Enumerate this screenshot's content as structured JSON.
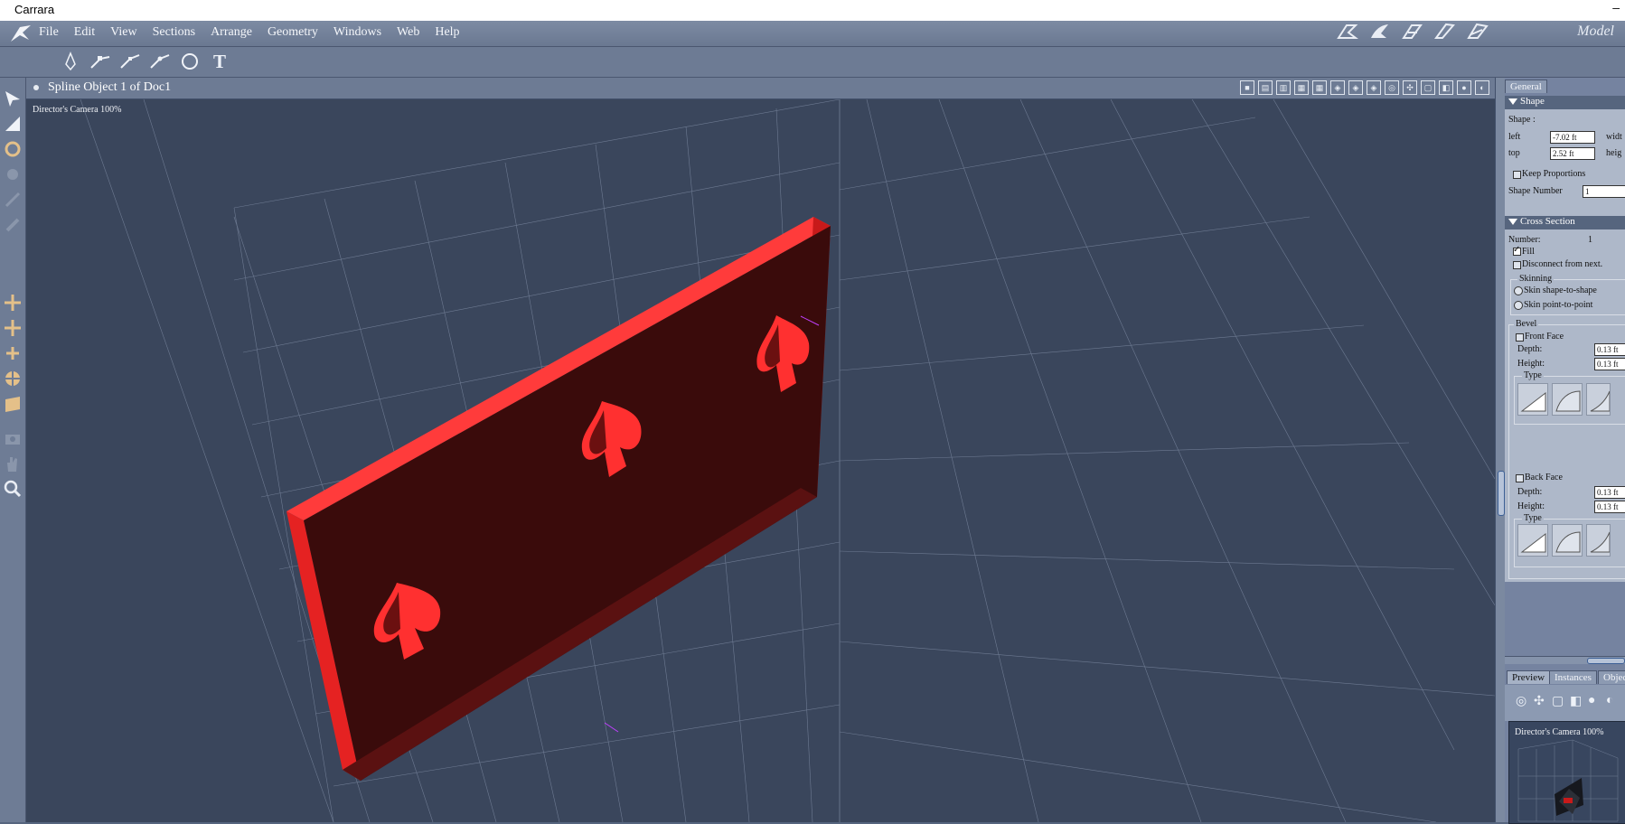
{
  "window": {
    "title": "Carrara"
  },
  "menu": {
    "items": [
      "File",
      "Edit",
      "View",
      "Sections",
      "Arrange",
      "Geometry",
      "Windows",
      "Web",
      "Help"
    ]
  },
  "room": {
    "label": "Model"
  },
  "toolbar": {
    "tools": [
      "pen-tool",
      "point-tool-a",
      "point-tool-b",
      "point-tool-c",
      "ellipse-tool",
      "text-tool"
    ],
    "text_tool_glyph": "T"
  },
  "viewport": {
    "title": "Spline Object 1 of Doc1",
    "camera_label": "Director's Camera 100%"
  },
  "properties": {
    "tab_general": "General",
    "shape": {
      "header": "Shape",
      "shape_label": "Shape :",
      "left_label": "left",
      "left_value": "-7.02 ft",
      "width_label": "widt",
      "top_label": "top",
      "top_value": "2.52 ft",
      "height_label": "heig",
      "keep_proportions": "Keep Proportions",
      "shape_number_label": "Shape Number",
      "shape_number_value": "1"
    },
    "cross_section": {
      "header": "Cross Section",
      "number_label": "Number:",
      "number_value": "1",
      "fill_label": "Fill",
      "disconnect_label": "Disconnect from next.",
      "skinning_label": "Skinning",
      "skin_shape": "Skin shape-to-shape",
      "skin_point": "Skin point-to-point",
      "bevel_label": "Bevel",
      "front_face": "Front Face",
      "depth_label": "Depth:",
      "front_depth": "0.13 ft",
      "height_label": "Height:",
      "front_height": "0.13 ft",
      "type_label": "Type",
      "back_face": "Back Face",
      "back_depth": "0.13 ft",
      "back_height": "0.13 ft"
    }
  },
  "bottom_tabs": [
    "Preview",
    "Instances",
    "Objects"
  ],
  "preview": {
    "camera_label": "Director's Camera 100%"
  },
  "colors": {
    "object": "#c81a1a",
    "object_dark": "#3a0b0b",
    "grid": "#8d9ab0"
  }
}
